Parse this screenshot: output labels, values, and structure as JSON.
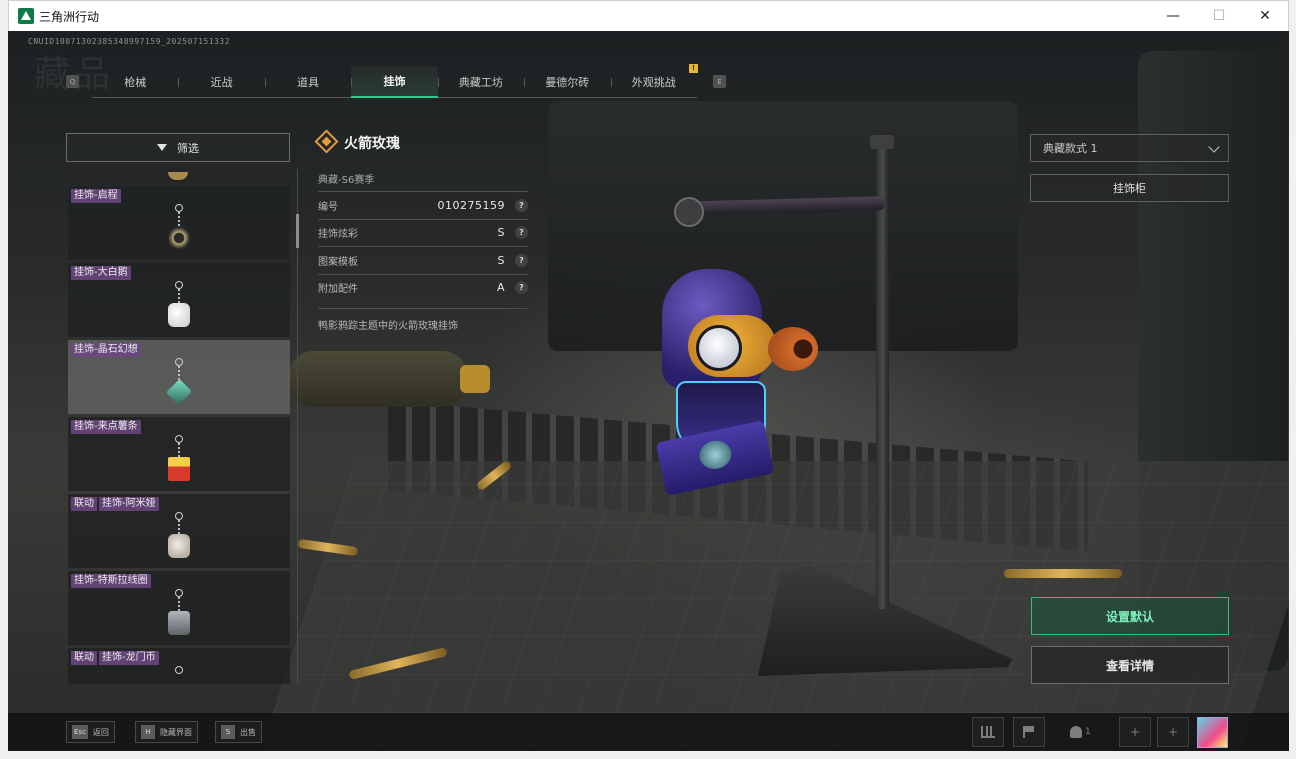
{
  "window": {
    "title": "三角洲行动",
    "minimize": "—",
    "maximize": "☐",
    "close": "✕"
  },
  "header": {
    "uid": "CNUID10071302385348997159_202507151332",
    "watermark": "藏品",
    "left_key": "Q",
    "right_key": "E",
    "notif": "!"
  },
  "tabs": [
    {
      "label": "枪械",
      "active": false
    },
    {
      "label": "近战",
      "active": false
    },
    {
      "label": "道具",
      "active": false
    },
    {
      "label": "挂饰",
      "active": true
    },
    {
      "label": "典藏工坊",
      "active": false
    },
    {
      "label": "曼德尔砖",
      "active": false
    },
    {
      "label": "外观挑战",
      "active": false
    }
  ],
  "filter": {
    "label": "筛选"
  },
  "list": {
    "items": [
      {
        "tags": [
          "挂饰-启程"
        ],
        "color": "#b8a470"
      },
      {
        "tags": [
          "挂饰-大白鹅"
        ],
        "color": "#f1f1f1"
      },
      {
        "tags": [
          "挂饰-晶石幻想"
        ],
        "color": "#5aa38c",
        "selected": true
      },
      {
        "tags": [
          "挂饰-来点薯条"
        ],
        "color": "#e4a52c"
      },
      {
        "tags": [
          "联动",
          "挂饰-阿米娅"
        ],
        "color": "#e8e0d8"
      },
      {
        "tags": [
          "挂饰-特斯拉线圈"
        ],
        "color": "#9a9ea3"
      },
      {
        "tags": [
          "联动",
          "挂饰-龙门币"
        ],
        "color": "#c8c8c8"
      }
    ]
  },
  "info": {
    "title": "火箭玫瑰",
    "season": "典藏-S6赛季",
    "rows": [
      {
        "key": "编号",
        "value": "010275159",
        "help": "?"
      },
      {
        "key": "挂饰炫彩",
        "value": "S",
        "help": "?"
      },
      {
        "key": "图案模板",
        "value": "S",
        "help": "?"
      },
      {
        "key": "附加配件",
        "value": "A",
        "help": "?"
      }
    ],
    "description": "鸭影鸦踪主题中的火箭玫瑰挂饰"
  },
  "right": {
    "style_select": "典藏款式 1",
    "cabinet": "挂饰柜",
    "set_default": "设置默认",
    "view_details": "查看详情"
  },
  "bottom": {
    "hints": [
      {
        "key": "Esc",
        "label": "返回"
      },
      {
        "key": "H",
        "label": "隐藏界面"
      },
      {
        "key": "S",
        "label": "出售"
      }
    ],
    "friends_count": "1",
    "plus": "+"
  },
  "colors": {
    "accent": "#33c88a",
    "tag_bg": "#6d4882",
    "rarity": "#e39a3a"
  }
}
